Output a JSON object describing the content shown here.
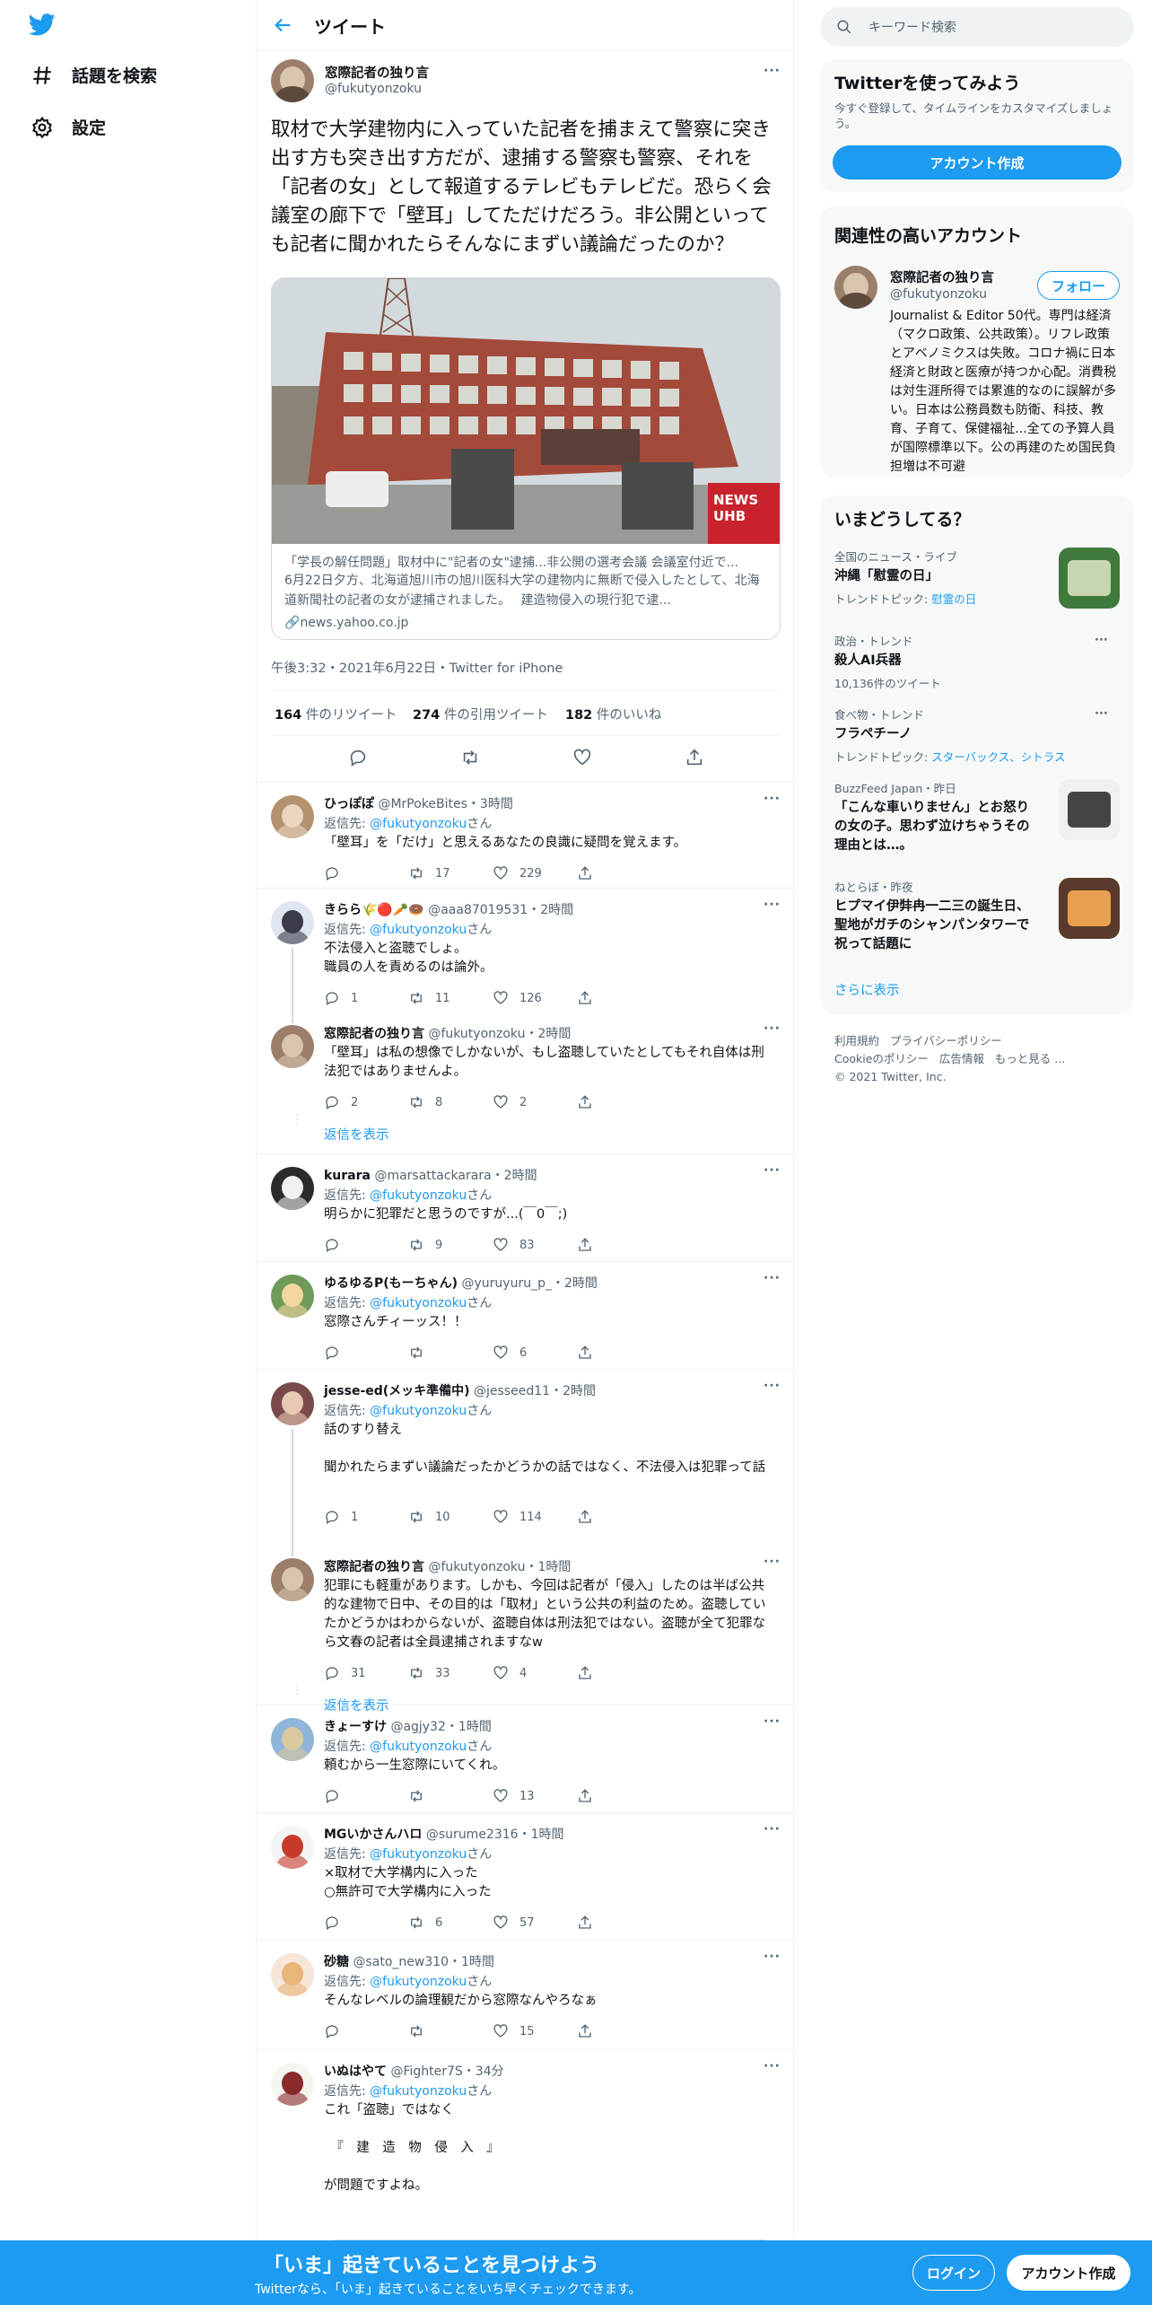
{
  "nav": {
    "explore": "話題を検索",
    "settings": "設定"
  },
  "header": {
    "title": "ツイート"
  },
  "main_tweet": {
    "name": "窓際記者の独り言",
    "handle": "@fukutyonzoku",
    "text": "取材で大学建物内に入っていた記者を捕まえて警察に突き出す方も突き出す方だが、逮捕する警察も警察、それを「記者の女」として報道するテレビもテレビだ。恐らく会議室の廊下で「壁耳」してただけだろう。非公開といっても記者に聞かれたらそんなにまずい議論だったのか？",
    "card_title": "「学長の解任問題」取材中に\"記者の女\"逮捕...非公開の選考会議 会議室付近で...",
    "card_desc": "6月22日夕方、北海道旭川市の旭川医科大学の建物内に無断で侵入したとして、北海道新聞社の記者の女が逮捕されました。　 建造物侵入の現行犯で逮...",
    "card_domain": "news.yahoo.co.jp",
    "news_badge": "NEWS UHB",
    "timestamp": "午後3:32・2021年6月22日・Twitter for iPhone",
    "retweets": "164",
    "retweets_label": "件のリツイート",
    "quotes": "274",
    "quotes_label": "件の引用ツイート",
    "likes": "182",
    "likes_label": "件のいいね"
  },
  "replying_to_prefix": "返信先: ",
  "replying_to_handle": "@fukutyonzoku",
  "replying_to_suffix": "さん",
  "show_replies": "返信を表示",
  "replies": [
    {
      "name": "ひっぽぽ",
      "handle": "@MrPokeBites",
      "time": "3時間",
      "text": "「壁耳」を「だけ」と思えるあなたの良識に疑問を覚えます。",
      "reply": "",
      "retweet": "17",
      "like": "229"
    },
    {
      "name": "きらら🌾🔴🥕🍩",
      "handle": "@aaa87019531",
      "time": "2時間",
      "text": "不法侵入と盗聴でしょ。\n職員の人を責めるのは論外。",
      "reply": "1",
      "retweet": "11",
      "like": "126"
    },
    {
      "name": "窓際記者の独り言",
      "handle": "@fukutyonzoku",
      "time": "2時間",
      "text": "「壁耳」は私の想像でしかないが、もし盗聴していたとしてもそれ自体は刑法犯ではありませんよ。",
      "reply": "2",
      "retweet": "8",
      "like": "2"
    },
    {
      "name": "kurara",
      "handle": "@marsattackarara",
      "time": "2時間",
      "text": "明らかに犯罪だと思うのですが...(￣0￣;)",
      "reply": "",
      "retweet": "9",
      "like": "83"
    },
    {
      "name": "ゆるゆるP(もーちゃん)",
      "handle": "@yuruyuru_p_",
      "time": "2時間",
      "text": "窓際さんチィーッス！！",
      "reply": "",
      "retweet": "",
      "like": "6"
    },
    {
      "name": "jesse-ed(メッキ準備中)",
      "handle": "@jesseed11",
      "time": "2時間",
      "text": "話のすり替え\n\n聞かれたらまずい議論だったかどうかの話ではなく、不法侵入は犯罪って話",
      "reply": "1",
      "retweet": "10",
      "like": "114"
    },
    {
      "name": "窓際記者の独り言",
      "handle": "@fukutyonzoku",
      "time": "1時間",
      "text": "犯罪にも軽重があります。しかも、今回は記者が「侵入」したのは半ば公共的な建物で日中、その目的は「取材」という公共の利益のため。盗聴していたかどうかはわからないが、盗聴自体は刑法犯ではない。盗聴が全て犯罪なら文春の記者は全員逮捕されますなw",
      "reply": "31",
      "retweet": "33",
      "like": "4"
    },
    {
      "name": "きょーすけ",
      "handle": "@agjy32",
      "time": "1時間",
      "text": "頼むから一生窓際にいてくれ。",
      "reply": "",
      "retweet": "",
      "like": "13"
    },
    {
      "name": "MGいかさんハロ",
      "handle": "@surume2316",
      "time": "1時間",
      "text": "×取材で大学構内に入った\n○無許可で大学構内に入った",
      "reply": "",
      "retweet": "6",
      "like": "57"
    },
    {
      "name": "砂糖",
      "handle": "@sato_new310",
      "time": "1時間",
      "text": "そんなレベルの論理観だから窓際なんやろなぁ",
      "reply": "",
      "retweet": "",
      "like": "15"
    },
    {
      "name": "いぬはやて",
      "handle": "@Fighter7S",
      "time": "34分",
      "text": "これ「盗聴」ではなく\n\n　『　建　造　物　侵　入　』\n\nが問題ですよね。",
      "reply": "",
      "retweet": "",
      "like": ""
    }
  ],
  "sidebar": {
    "search_placeholder": "キーワード検索",
    "signup": {
      "title": "Twitterを使ってみよう",
      "desc": "今すぐ登録して、タイムラインをカスタマイズしましょう。",
      "button": "アカウント作成"
    },
    "related": {
      "title": "関連性の高いアカウント",
      "name": "窓際記者の独り言",
      "handle": "@fukutyonzoku",
      "follow": "フォロー",
      "bio": "Journalist & Editor 50代。専門は経済（マクロ政策、公共政策）。リフレ政策とアベノミクスは失敗。コロナ禍に日本経済と財政と医療が持つか心配。消費税は対生涯所得では累進的なのに誤解が多い。日本は公務員数も防衛、科技、教育、子育て、保健福祉...全ての予算人員が国際標準以下。公の再建のため国民負担増は不可避"
    },
    "trends": {
      "title": "いまどうしてる？",
      "items": [
        {
          "meta": "全国のニュース・ライブ",
          "title": "沖縄「慰霊の日」",
          "sub_prefix": "トレンドトピック: ",
          "sub_link": "慰霊の日"
        },
        {
          "meta": "政治・トレンド",
          "title": "殺人AI兵器",
          "sub_prefix": "10,136件のツイート",
          "sub_link": ""
        },
        {
          "meta": "食べ物・トレンド",
          "title": "フラペチーノ",
          "sub_prefix": "トレンドトピック: ",
          "sub_link": "スターバックス、シトラス"
        },
        {
          "meta": "BuzzFeed Japan・昨日",
          "title": "「こんな車いりません」とお怒りの女の子。思わず泣けちゃうその理由とは…。",
          "sub_prefix": "",
          "sub_link": ""
        },
        {
          "meta": "ねとらぼ・昨夜",
          "title": "ヒプマイ伊弉冉一二三の誕生日、聖地がガチのシャンパンタワーで祝って話題に",
          "sub_prefix": "",
          "sub_link": ""
        }
      ],
      "more": "さらに表示"
    },
    "footer": {
      "l1": [
        "利用規約",
        "プライバシーポリシー"
      ],
      "l2": [
        "Cookieのポリシー",
        "広告情報",
        "もっと見る ..."
      ],
      "copy": "© 2021 Twitter, Inc."
    }
  },
  "bottom_bar": {
    "title": "「いま」起きていることを見つけよう",
    "sub": "Twitterなら、「いま」起きていることをいち早くチェックできます。",
    "login": "ログイン",
    "signup": "アカウント作成"
  },
  "colors": {
    "accent": "#1d9bf0",
    "text": "#0f1419",
    "muted": "#536471"
  }
}
